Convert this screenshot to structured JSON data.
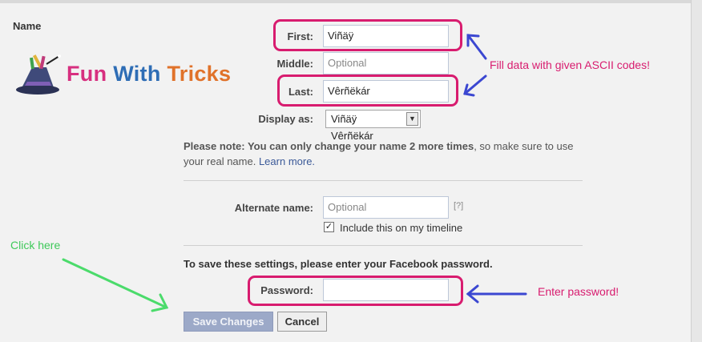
{
  "section": {
    "title": "Name"
  },
  "logo": {
    "word1": "Fun",
    "word2": "With",
    "word3": "Tricks",
    "colors": {
      "fun": "#d72f7f",
      "with": "#2e6db5",
      "tricks": "#e0722a"
    }
  },
  "form": {
    "first_label": "First:",
    "first_value": "Viñäÿ",
    "middle_label": "Middle:",
    "middle_placeholder": "Optional",
    "last_label": "Last:",
    "last_value": "Vêrñëkár",
    "display_label": "Display as:",
    "display_value": "Viñäÿ Vêrñëkár",
    "note_bold": "Please note: You can only change your name 2 more times",
    "note_rest": ", so make sure to use your real name.",
    "note_link": "Learn more.",
    "alternate_label": "Alternate name:",
    "alternate_placeholder": "Optional",
    "alternate_help": "[?]",
    "include_label": "Include this on my timeline",
    "include_checked": true,
    "save_instruction": "To save these settings, please enter your Facebook password.",
    "password_label": "Password:",
    "password_value": ""
  },
  "buttons": {
    "save": "Save Changes",
    "cancel": "Cancel"
  },
  "annotations": {
    "fill_data": "Fill data with given ASCII codes!",
    "click_here": "Click here",
    "enter_password": "Enter password!",
    "colors": {
      "highlight": "#d81c6f",
      "blue_arrow": "#3b47d1",
      "green_arrow": "#4bdb6b",
      "pink_text": "#d81c6f",
      "green_text": "#3fc95a"
    }
  }
}
